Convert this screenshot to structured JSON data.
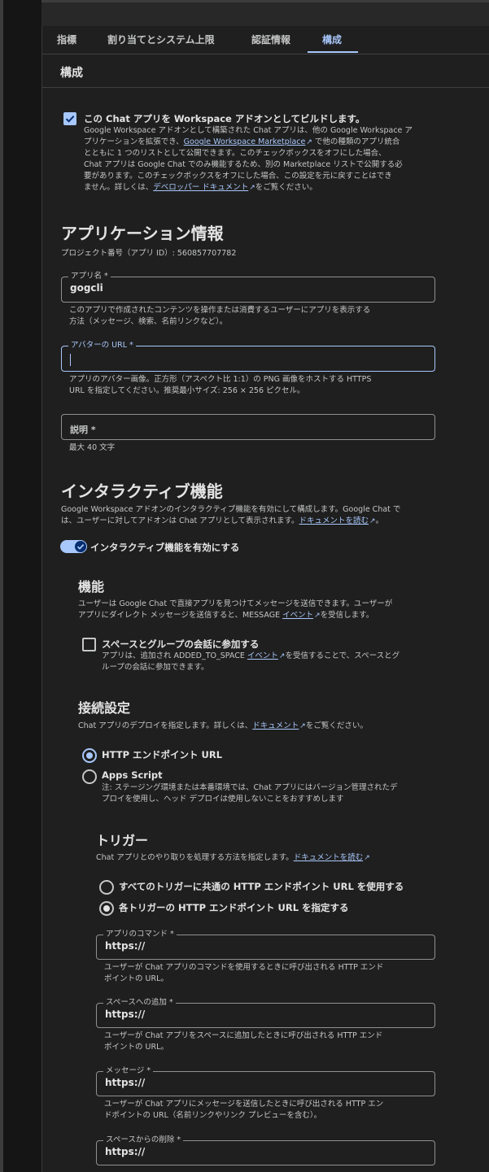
{
  "tabs": [
    {
      "label": "指標"
    },
    {
      "label": "割り当てとシステム上限"
    },
    {
      "label": "認証情報"
    },
    {
      "label": "構成"
    }
  ],
  "section_title": "構成",
  "addon": {
    "checkbox_label": "この Chat アプリを Workspace アドオンとしてビルドします。",
    "desc_1": "Google Workspace アドオンとして構築された Chat アプリは、他の Google Workspace ア",
    "desc_2a": "プリケーションを拡張でき、",
    "desc_2_link": "Google Workspace Marketplace",
    "desc_2b": " で他の種類のアプリ統合",
    "desc_3": "とともに 1 つのリストとして公開できます。このチェックボックスをオフにした場合、",
    "desc_4": "Chat アプリは Google Chat でのみ機能するため、別の Marketplace リストで公開する必",
    "desc_5": "要があります。このチェックボックスをオフにした場合、この設定を元に戻すことはでき",
    "desc_6a": "ません。詳しくは、",
    "desc_6_link": "デベロッパー ドキュメント",
    "desc_6b": "をご覧ください。"
  },
  "app_info": {
    "heading": "アプリケーション情報",
    "project_number": "プロジェクト番号（アプリ ID）: 560857707782",
    "app_name_label": "アプリ名 *",
    "app_name_value": "gogcli",
    "app_name_help_1": "このアプリで作成されたコンテンツを操作または消費するユーザーにアプリを表示する",
    "app_name_help_2": "方法（メッセージ、検索、名前リンクなど）。",
    "avatar_label": "アバターの URL *",
    "avatar_help_1": "アプリのアバター画像。正方形（アスペクト比 1:1）の PNG 画像をホストする HTTPS",
    "avatar_help_2": "URL を指定してください。推奨最小サイズ: 256 × 256 ピクセル。",
    "description_placeholder": "説明 *",
    "description_help": "最大 40 文字"
  },
  "interactive": {
    "heading": "インタラクティブ機能",
    "desc_1": "Google Workspace アドオンのインタラクティブ機能を有効にして構成します。Google Chat で",
    "desc_2a": "は、ユーザーに対してアドオンは Chat アプリとして表示されます。",
    "desc_2_link": "ドキュメントを読む",
    "desc_2b": "。",
    "toggle_label": "インタラクティブ機能を有効にする"
  },
  "features": {
    "heading": "機能",
    "desc_1": "ユーザーは Google Chat で直接アプリを見つけてメッセージを送信できます。ユーザーが",
    "desc_2a": "アプリにダイレクト メッセージを送信すると、MESSAGE ",
    "desc_2_link": "イベント",
    "desc_2b": "を受信します。",
    "join_label": "スペースとグループの会話に参加する",
    "join_desc_1a": "アプリは、追加され ADDED_TO_SPACE ",
    "join_desc_1_link": "イベント",
    "join_desc_1b": "を受信することで、スペースとグ",
    "join_desc_2": "ループの会話に参加できます。"
  },
  "connection": {
    "heading": "接続設定",
    "desc_a": "Chat アプリのデプロイを指定します。詳しくは、",
    "desc_link": "ドキュメント",
    "desc_b": "をご覧ください。",
    "option_http": "HTTP エンドポイント URL",
    "option_apps_script": "Apps Script",
    "apps_script_note_1": "注: ステージング環境または本番環境では、Chat アプリにはバージョン管理されたデ",
    "apps_script_note_2": "プロイを使用し、ヘッド デプロイは使用しないことをおすすめします"
  },
  "triggers": {
    "heading": "トリガー",
    "desc_a": "Chat アプリとのやり取りを処理する方法を指定します。",
    "desc_link": "ドキュメントを読む",
    "option_common": "すべてのトリガーに共通の HTTP エンドポイント URL を使用する",
    "option_each": "各トリガーの HTTP エンドポイント URL を指定する",
    "fields": [
      {
        "label": "アプリのコマンド *",
        "value": "https://",
        "help_1": "ユーザーが Chat アプリのコマンドを使用するときに呼び出される HTTP エンド",
        "help_2": "ポイントの URL。"
      },
      {
        "label": "スペースへの追加 *",
        "value": "https://",
        "help_1": "ユーザーが Chat アプリをスペースに追加したときに呼び出される HTTP エンド",
        "help_2": "ポイントの URL。"
      },
      {
        "label": "メッセージ *",
        "value": "https://",
        "help_1": "ユーザーが Chat アプリにメッセージを送信したときに呼び出される HTTP エン",
        "help_2": "ドポイントの URL（名前リンクやリンク プレビューを含む）。"
      },
      {
        "label": "スペースからの削除 *",
        "value": "https://"
      }
    ]
  },
  "colors": {
    "accent": "#a8c7fa",
    "background": "#1f1f1f",
    "text": "#e3e3e3",
    "muted": "#c4c7c5"
  }
}
